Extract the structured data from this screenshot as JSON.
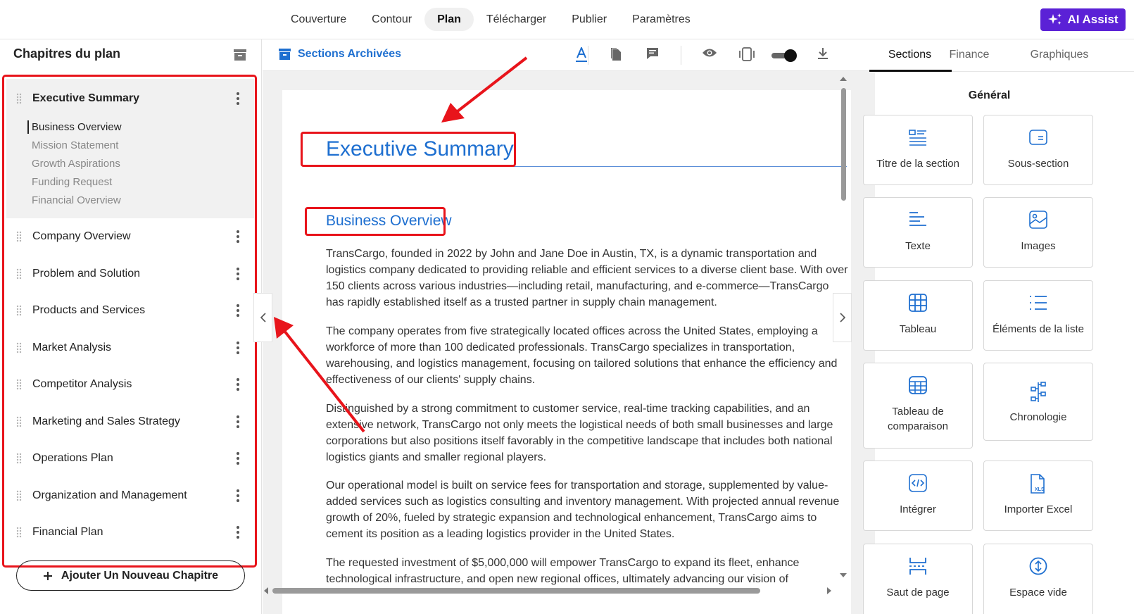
{
  "topnav": {
    "tabs": [
      {
        "label": "Couverture"
      },
      {
        "label": "Contour"
      },
      {
        "label": "Plan"
      },
      {
        "label": "Télécharger"
      },
      {
        "label": "Publier"
      },
      {
        "label": "Paramètres"
      }
    ],
    "active_tab": "Plan",
    "ai_assist_label": "AI Assist"
  },
  "sidebar": {
    "title": "Chapitres du plan",
    "chapters": [
      {
        "label": "Executive Summary",
        "expanded": true
      },
      {
        "label": "Company Overview"
      },
      {
        "label": "Problem and Solution"
      },
      {
        "label": "Products and Services"
      },
      {
        "label": "Market Analysis"
      },
      {
        "label": "Competitor Analysis"
      },
      {
        "label": "Marketing and Sales Strategy"
      },
      {
        "label": "Operations Plan"
      },
      {
        "label": "Organization and Management"
      },
      {
        "label": "Financial Plan"
      }
    ],
    "subsections": [
      {
        "label": "Business Overview",
        "current": true
      },
      {
        "label": "Mission Statement"
      },
      {
        "label": "Growth Aspirations"
      },
      {
        "label": "Funding Request"
      },
      {
        "label": "Financial Overview"
      }
    ],
    "add_chapter_label": "Ajouter Un Nouveau Chapitre"
  },
  "editor": {
    "archived_label": "Sections Archivées",
    "toolbar_icons": [
      "text-color-icon",
      "document-icon",
      "comment-icon",
      "preview-icon",
      "device-icon",
      "toggle-switch",
      "download-icon"
    ],
    "document": {
      "title": "Executive Summary",
      "heading": "Business Overview",
      "paragraphs": [
        "TransCargo, founded in 2022 by John and Jane Doe in Austin, TX, is a dynamic transportation and logistics company dedicated to providing reliable and efficient services to a diverse client base. With over 150 clients across various industries—including retail, manufacturing, and e-commerce—TransCargo has rapidly established itself as a trusted partner in supply chain management.",
        "The company operates from five strategically located offices across the United States, employing a workforce of more than 100 dedicated professionals. TransCargo specializes in transportation, warehousing, and logistics management, focusing on tailored solutions that enhance the efficiency and effectiveness of our clients' supply chains.",
        "Distinguished by a strong commitment to customer service, real-time tracking capabilities, and an extensive network, TransCargo not only meets the logistical needs of both small businesses and large corporations but also positions itself favorably in the competitive landscape that includes both national logistics giants and smaller regional players.",
        "Our operational model is built on service fees for transportation and storage, supplemented by value-added services such as logistics consulting and inventory management. With projected annual revenue growth of 20%, fueled by strategic expansion and technological enhancement, TransCargo aims to cement its position as a leading logistics provider in the United States.",
        "The requested investment of $5,000,000 will empower TransCargo to expand its fleet, enhance technological infrastructure, and open new regional offices, ultimately advancing our vision of"
      ]
    }
  },
  "rpanel": {
    "tabs": [
      {
        "label": "Sections"
      },
      {
        "label": "Finance"
      },
      {
        "label": "Graphiques"
      }
    ],
    "active_tab": "Sections",
    "group_title": "Général",
    "items": [
      {
        "label": "Titre de la section",
        "icon": "section-title-icon"
      },
      {
        "label": "Sous-section",
        "icon": "subsection-icon"
      },
      {
        "label": "Texte",
        "icon": "text-icon"
      },
      {
        "label": "Images",
        "icon": "image-icon"
      },
      {
        "label": "Tableau",
        "icon": "table-icon"
      },
      {
        "label": "Éléments de la liste",
        "icon": "list-icon"
      },
      {
        "label": "Tableau de comparaison",
        "icon": "comparison-table-icon"
      },
      {
        "label": "Chronologie",
        "icon": "timeline-icon"
      },
      {
        "label": "Intégrer",
        "icon": "embed-icon"
      },
      {
        "label": "Importer Excel",
        "icon": "excel-icon"
      },
      {
        "label": "Saut de page",
        "icon": "page-break-icon"
      },
      {
        "label": "Espace vide",
        "icon": "empty-space-icon"
      }
    ]
  },
  "colors": {
    "accent": "#1e6fd0",
    "ai_button": "#5b21d6",
    "annotation_red": "#e8141b"
  }
}
